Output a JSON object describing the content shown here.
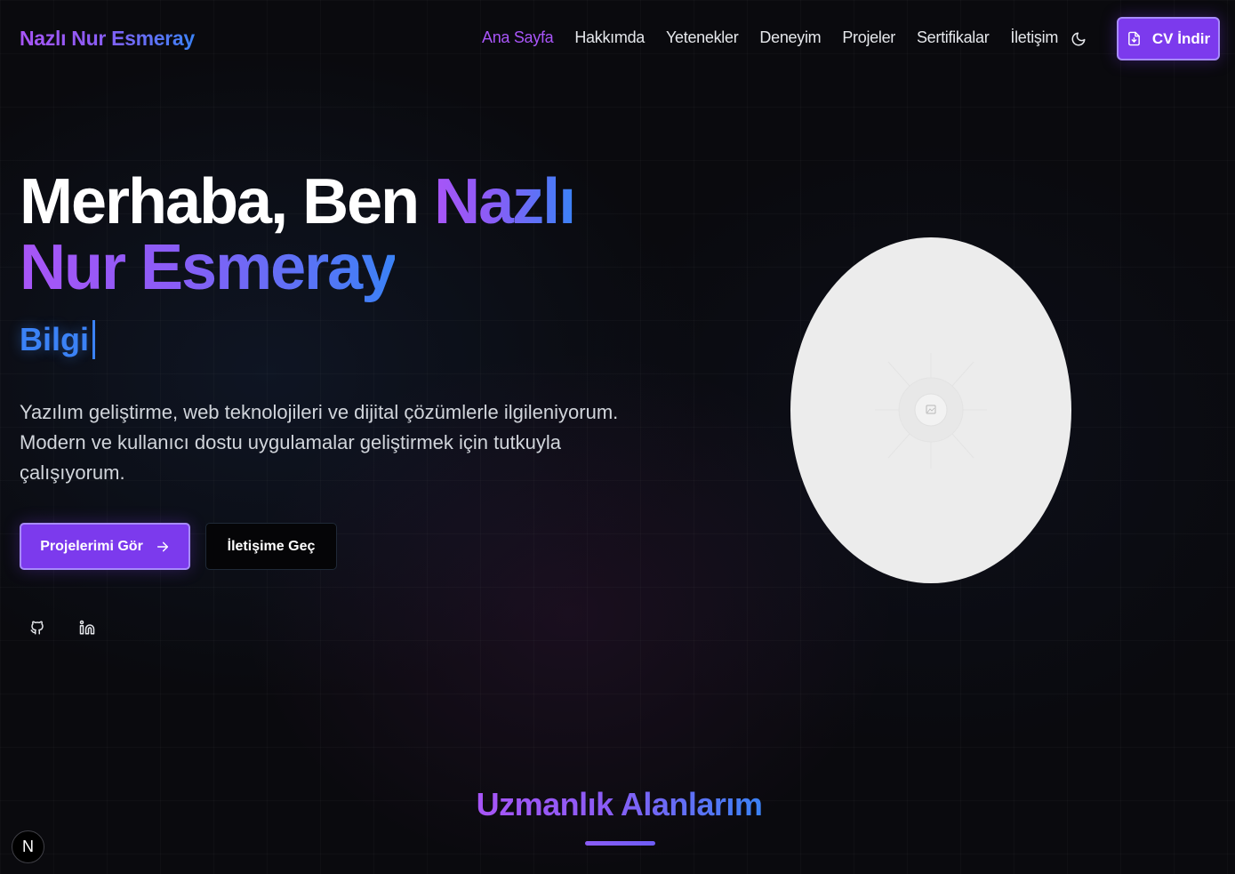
{
  "nav": {
    "brand": "Nazlı Nur Esmeray",
    "links": [
      {
        "label": "Ana Sayfa",
        "active": true
      },
      {
        "label": "Hakkımda"
      },
      {
        "label": "Yetenekler"
      },
      {
        "label": "Deneyim"
      },
      {
        "label": "Projeler"
      },
      {
        "label": "Sertifikalar"
      },
      {
        "label": "İletişim"
      }
    ],
    "theme_icon": "moon-icon",
    "cv_button": {
      "label": "CV İndir",
      "icon": "file-download-icon"
    }
  },
  "hero": {
    "title_prefix": "Merhaba, Ben ",
    "title_name_line1": "Nazlı",
    "title_name_line2": "Nur Esmeray",
    "typed_text": "Bilgi",
    "description": "Yazılım geliştirme, web teknolojileri ve dijital çözümlerle ilgileniyorum. Modern ve kullanıcı dostu uygulamalar geliştirmek için tutkuyla çalışıyorum.",
    "primary_button": "Projelerimi Gör",
    "secondary_button": "İletişime Geç",
    "social": [
      {
        "icon": "github-icon"
      },
      {
        "icon": "linkedin-icon"
      }
    ],
    "avatar_icon": "image-placeholder-icon"
  },
  "section": {
    "title": "Uzmanlık Alanlarım"
  },
  "badge": {
    "label": "N"
  },
  "colors": {
    "accent": "#7c3aed",
    "accent_light": "#a855f7",
    "gradient_end": "#3b82f6",
    "background": "#0a0a0e"
  }
}
